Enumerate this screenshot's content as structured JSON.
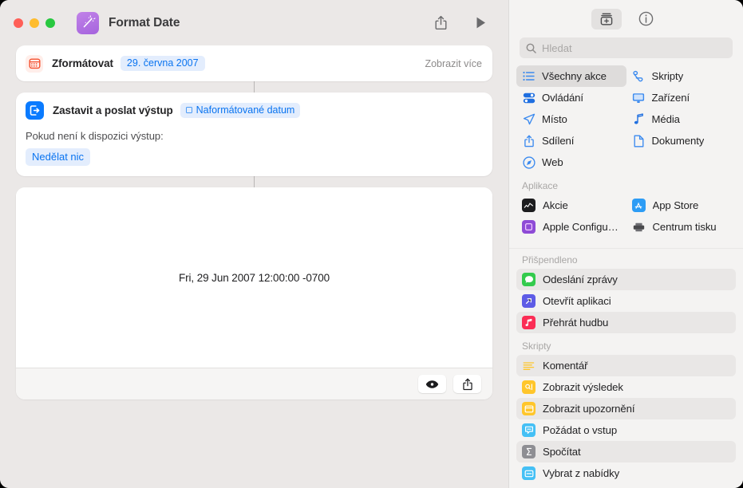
{
  "window": {
    "title": "Format Date",
    "app_icon": "magic-wand-icon",
    "traffic_lights": [
      "close",
      "minimize",
      "zoom"
    ],
    "toolbar": {
      "share_label": "share-icon",
      "run_label": "play-icon"
    }
  },
  "workflow": {
    "action1": {
      "icon": "calendar-icon",
      "label": "Zformátovat",
      "token": "29. června 2007",
      "show_more": "Zobrazit více"
    },
    "action2": {
      "icon": "stop-and-output-icon",
      "label": "Zastavit a poslat výstup",
      "token": "Naformátované datum",
      "sub_label": "Pokud není k dispozici výstup:",
      "chip": "Nedělat nic"
    },
    "preview": {
      "result": "Fri, 29 Jun 2007 12:00:00 -0700",
      "buttons": [
        {
          "name": "quick-look-button",
          "icon": "eye-icon"
        },
        {
          "name": "share-result-button",
          "icon": "share-icon"
        }
      ]
    }
  },
  "library": {
    "toolbar": [
      {
        "name": "action-library-button",
        "icon": "library-box-icon",
        "active": true
      },
      {
        "name": "info-button",
        "icon": "info-circle-icon",
        "active": false
      }
    ],
    "search": {
      "placeholder": "Hledat",
      "value": "",
      "icon": "search-icon"
    },
    "categories": [
      {
        "label": "Všechny akce",
        "icon": "list-icon",
        "color": "#3b8aef",
        "selected": true
      },
      {
        "label": "Skripty",
        "icon": "scroll-icon",
        "color": "#3b8aef",
        "selected": false
      },
      {
        "label": "Ovládání",
        "icon": "sliders-icon",
        "color": "#1f6fe0",
        "selected": false
      },
      {
        "label": "Zařízení",
        "icon": "display-icon",
        "color": "#3b8aef",
        "selected": false
      },
      {
        "label": "Místo",
        "icon": "location-arrow-icon",
        "color": "#3b8aef",
        "selected": false
      },
      {
        "label": "Média",
        "icon": "music-note-icon",
        "color": "#1f6fe0",
        "selected": false
      },
      {
        "label": "Sdílení",
        "icon": "share-up-icon",
        "color": "#3b8aef",
        "selected": false
      },
      {
        "label": "Dokumenty",
        "icon": "document-icon",
        "color": "#3b8aef",
        "selected": false
      },
      {
        "label": "Web",
        "icon": "compass-icon",
        "color": "#3b8aef",
        "selected": false
      }
    ],
    "apps_section": {
      "header": "Aplikace",
      "items": [
        {
          "label": "Akcie",
          "icon": "stocks-app-icon",
          "color": "#1c1c1e"
        },
        {
          "label": "App Store",
          "icon": "app-store-icon",
          "color": "#2d9cf5"
        },
        {
          "label": "Apple Configurator",
          "icon": "apple-configurator-icon",
          "color": "#8e4bd6"
        },
        {
          "label": "Centrum tisku",
          "icon": "print-center-icon",
          "color": "#6e6e73"
        }
      ]
    },
    "pinned_section": {
      "header": "Přišpendleno",
      "items": [
        {
          "label": "Odeslání zprávy",
          "icon": "messages-icon",
          "color": "#33cb4d",
          "alt": true
        },
        {
          "label": "Otevřít aplikaci",
          "icon": "open-app-icon",
          "color": "#5e5ce6",
          "alt": false
        },
        {
          "label": "Přehrát hudbu",
          "icon": "music-app-icon",
          "color": "#fb2d55",
          "alt": true
        }
      ]
    },
    "scripts_section": {
      "header": "Skripty",
      "items": [
        {
          "label": "Komentář",
          "icon": "comment-lines-icon",
          "color": "#ffc62b",
          "alt": true
        },
        {
          "label": "Zobrazit výsledek",
          "icon": "show-result-icon",
          "color": "#ffc62b",
          "alt": false
        },
        {
          "label": "Zobrazit upozornění",
          "icon": "show-alert-icon",
          "color": "#ffc62b",
          "alt": true
        },
        {
          "label": "Požádat o vstup",
          "icon": "ask-input-icon",
          "color": "#45c0f5",
          "alt": false
        },
        {
          "label": "Spočítat",
          "icon": "calculate-sigma-icon",
          "color": "#8e8e93",
          "alt": true
        },
        {
          "label": "Vybrat z nabídky",
          "icon": "choose-menu-icon",
          "color": "#45c0f5",
          "alt": false
        }
      ]
    }
  },
  "colors": {
    "accent_blue": "#0a74f0",
    "token_bg": "#e3edfd",
    "window_bg": "#ebe8e7",
    "sidebar_bg": "#f4f3f2"
  }
}
